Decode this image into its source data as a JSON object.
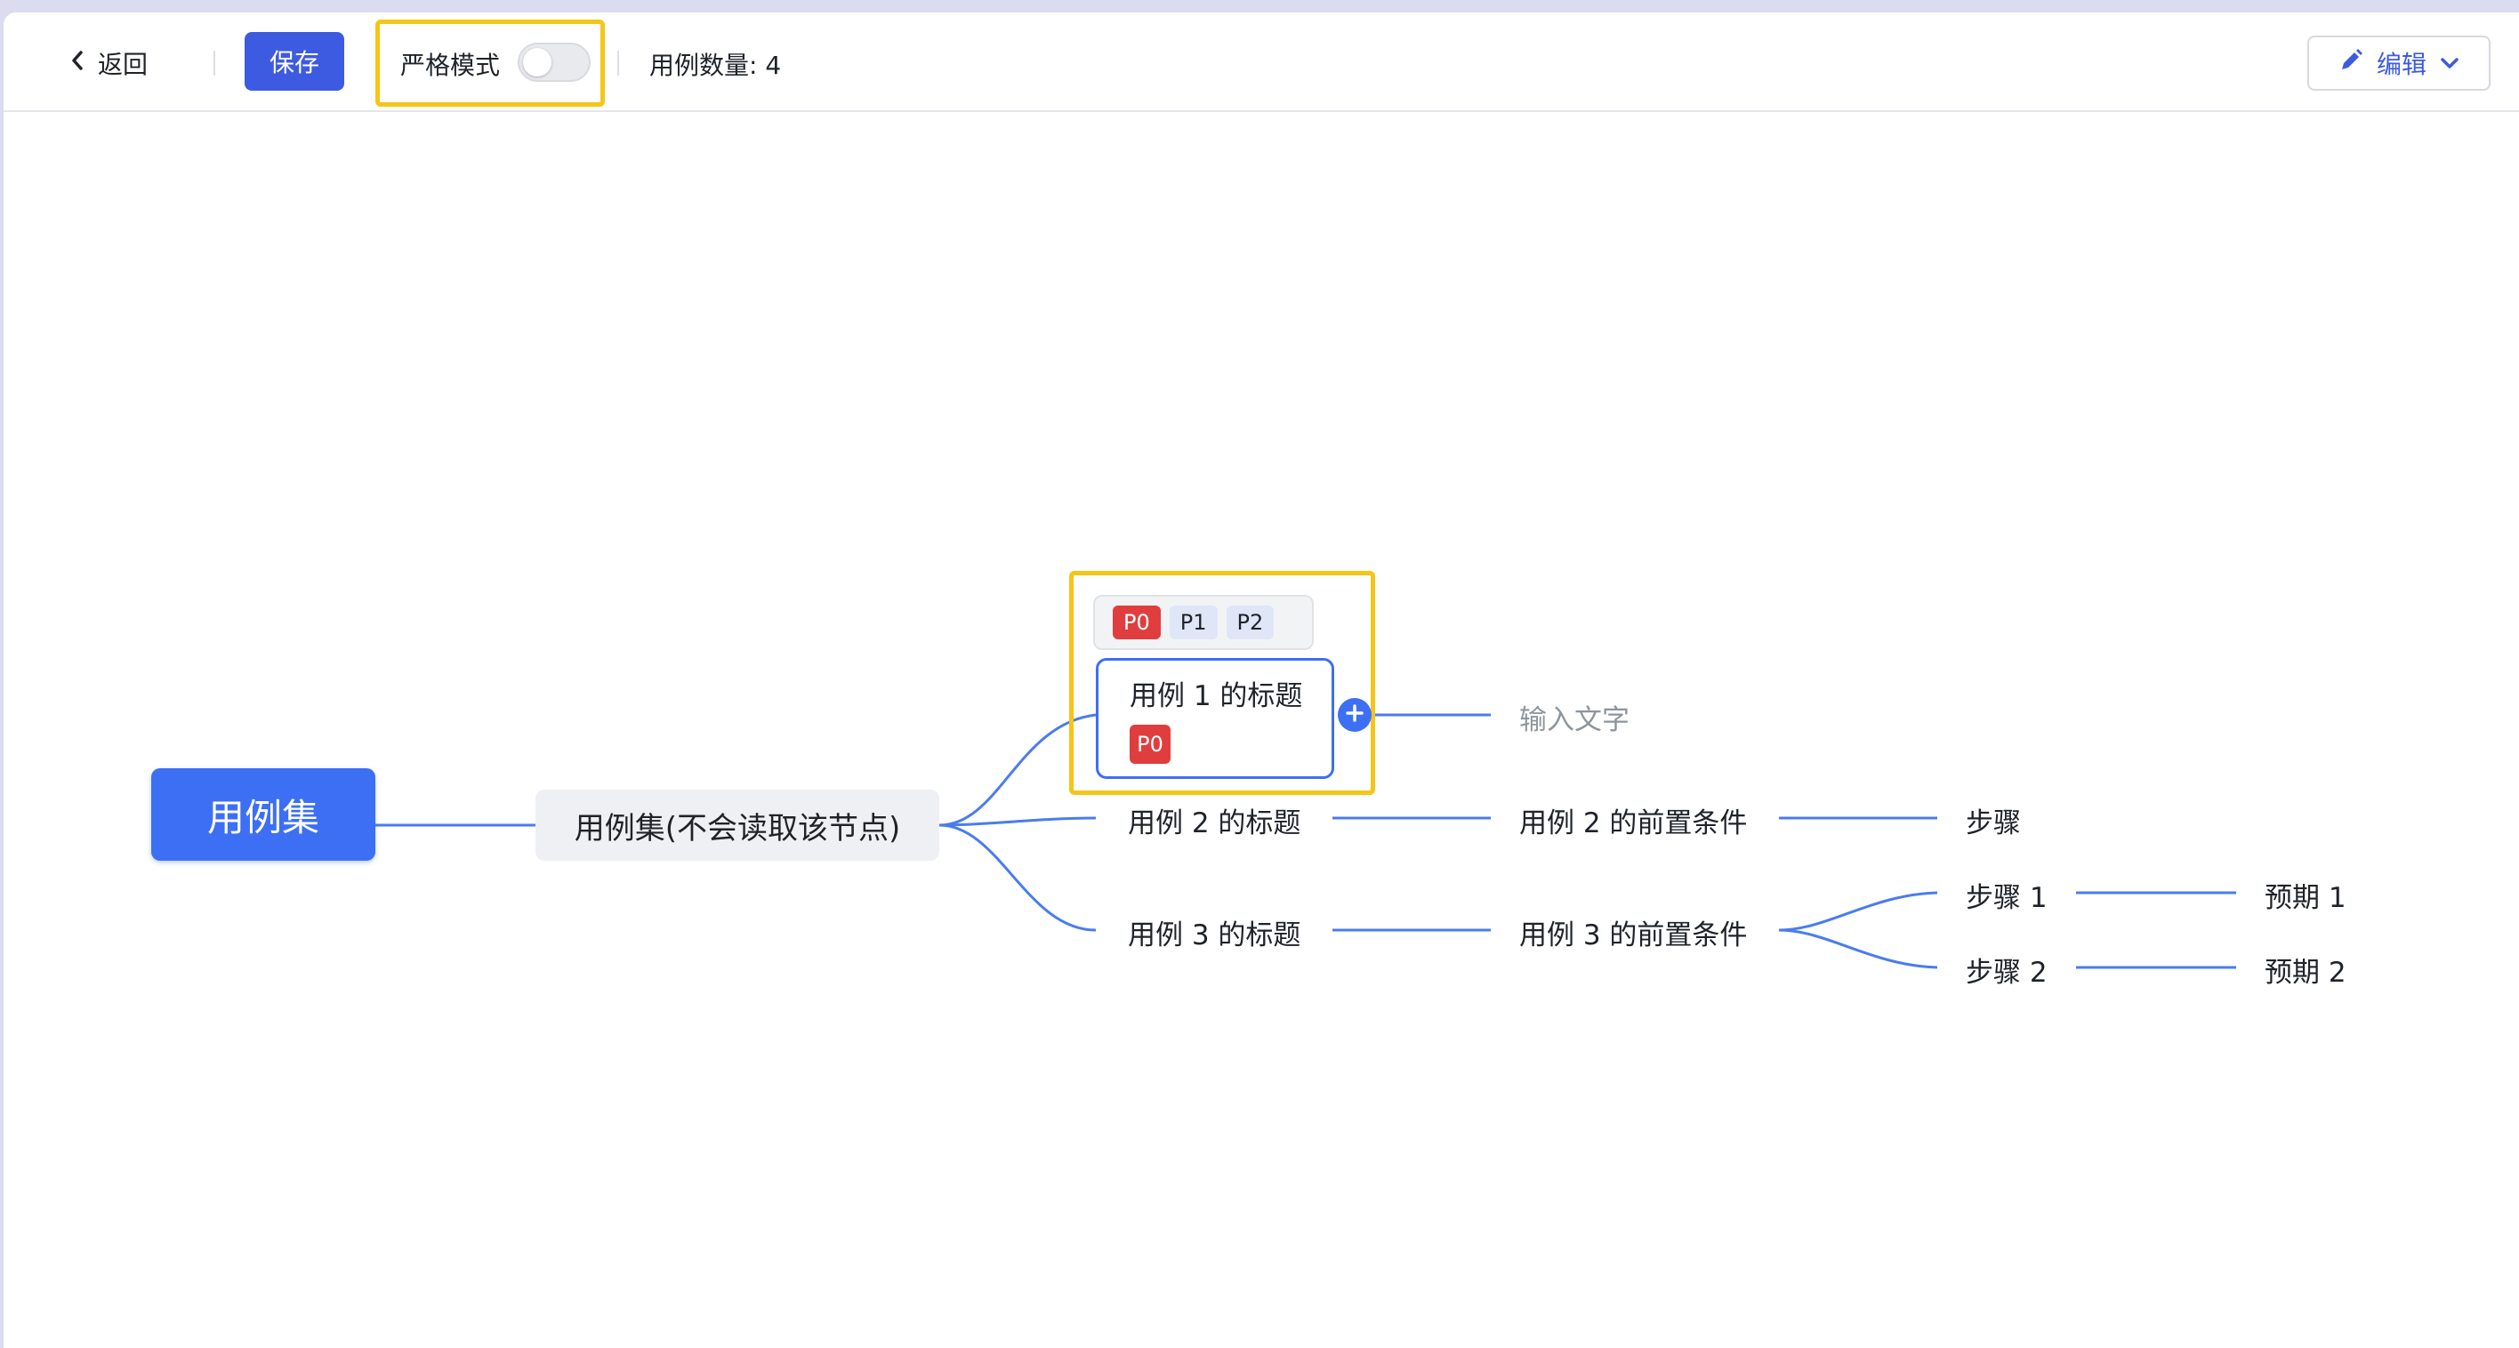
{
  "toolbar": {
    "back_label": "返回",
    "save_label": "保存",
    "strict_mode_label": "严格模式",
    "strict_mode_on": false,
    "case_count_text": "用例数量: 4",
    "edit_label": "编辑"
  },
  "mindmap": {
    "root": "用例集",
    "case_set": "用例集(不会读取该节点)",
    "priority_options": [
      "P0",
      "P1",
      "P2"
    ],
    "case1": {
      "title": "用例 1 的标题",
      "priority": "P0",
      "input_placeholder": "输入文字"
    },
    "case2": {
      "title": "用例 2 的标题",
      "precondition": "用例 2 的前置条件",
      "step": "步骤"
    },
    "case3": {
      "title": "用例 3 的标题",
      "precondition": "用例 3 的前置条件",
      "steps": [
        {
          "step": "步骤 1",
          "expected": "预期 1"
        },
        {
          "step": "步骤 2",
          "expected": "预期 2"
        }
      ]
    }
  },
  "colors": {
    "accent": "#3d5be0",
    "node_blue": "#3d6ff5",
    "priority_red": "#e03e3e",
    "highlight_yellow": "#f5c518",
    "line": "#4a7cf0"
  }
}
